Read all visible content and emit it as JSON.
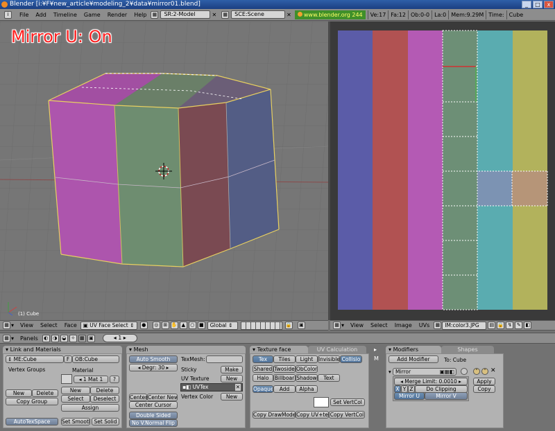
{
  "window": {
    "title": "Blender [i:¥F¥new_article¥modeling_2¥data¥mirror01.blend]"
  },
  "menubar": {
    "items": [
      "File",
      "Add",
      "Timeline",
      "Game",
      "Render",
      "Help"
    ],
    "screen": "SR:2-Model",
    "scene": "SCE:Scene",
    "url": "www.blender.org 244",
    "stats": [
      "Ve:17",
      "Fa:12",
      "Ob:0-0",
      "La:0",
      "Mem:9.29M",
      "Time:",
      "Cube"
    ]
  },
  "viewport": {
    "overlay": "Mirror U: On",
    "object_label": "(1) Cube",
    "header": {
      "menus": [
        "View",
        "Select",
        "Face"
      ],
      "mode": "UV Face Select",
      "orientation": "Global"
    }
  },
  "uv_editor": {
    "header": {
      "menus": [
        "View",
        "Select",
        "Image",
        "UVs"
      ],
      "image": "IM:color3.JPG"
    },
    "texture_columns": [
      "#5b5ca8",
      "#b15252",
      "#b45ab4",
      "#6d8f76",
      "#5aacb0",
      "#b2b25c"
    ]
  },
  "buttons_header": {
    "panels_label": "Panels",
    "frame": "1"
  },
  "link_materials": {
    "title": "Link and Materials",
    "me_field": "ME:Cube",
    "f_label": "F",
    "ob_field": "OB:Cube",
    "vertex_groups": "Vertex Groups",
    "material": "Material",
    "mat_count": "1 Mat 1",
    "q": "?",
    "new1": "New",
    "delete1": "Delete",
    "copy_group": "Copy Group",
    "new2": "New",
    "delete2": "Delete",
    "select": "Select",
    "deselect": "Deselect",
    "assign": "Assign",
    "autotexspace": "AutoTexSpace",
    "set_smooth": "Set Smooth",
    "set_solid": "Set Solid"
  },
  "mesh": {
    "title": "Mesh",
    "auto_smooth": "Auto Smooth",
    "degr": "Degr: 30",
    "center": "Center",
    "center_new": "Center New",
    "center_cursor": "Center Cursor",
    "double_sided": "Double Sided",
    "no_vnormal_flip": "No V.Normal Flip",
    "texmesh": "TexMesh:",
    "sticky": "Sticky",
    "make": "Make",
    "uv_texture": "UV Texture",
    "new": "New",
    "uvtex": "UVTex",
    "x": "✕",
    "vertex_color": "Vertex Color",
    "new2": "New"
  },
  "texture_face": {
    "tab1": "Texture face",
    "tab2": "UV Calculation",
    "row1": [
      "Tex",
      "Tiles",
      "Light",
      "Invisible",
      "Collisio"
    ],
    "row2": [
      "Shared",
      "Twoside",
      "ObColor"
    ],
    "row3": [
      "Halo",
      "Billboar",
      "Shadow",
      "Text"
    ],
    "row4": [
      "Opaque",
      "Add",
      "Alpha"
    ],
    "set_vertcol": "Set VertCol",
    "copy_drawmode": "Copy DrawMode",
    "copy_uvte": "Copy UV+te",
    "copy_vertcol": "Copy VertCol"
  },
  "modifiers": {
    "side_label": "M",
    "tab1": "Modifiers",
    "tab2": "Shapes",
    "add_modifier": "Add Modifier",
    "to": "To: Cube",
    "mirror": "Mirror",
    "merge_limit": "Merge Limit: 0.0010",
    "axes": [
      "X",
      "Y",
      "Z"
    ],
    "do_clipping": "Do Clipping",
    "mirror_u": "Mirror U",
    "mirror_v": "Mirror V",
    "apply": "Apply",
    "copy": "Copy"
  }
}
